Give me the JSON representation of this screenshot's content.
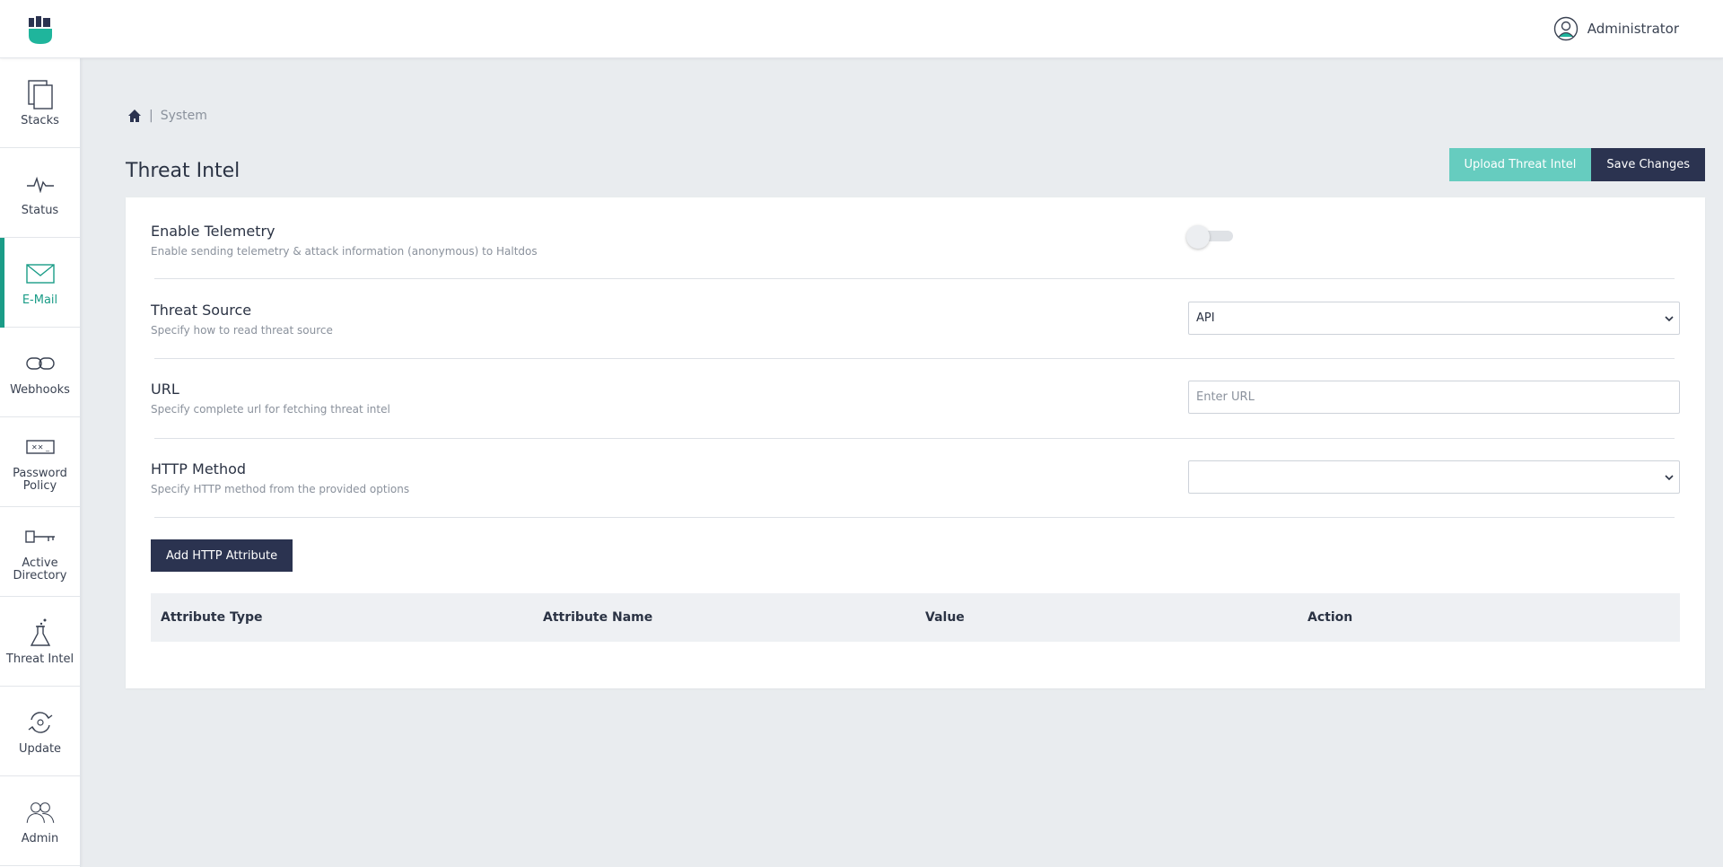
{
  "header": {
    "user_name": "Administrator"
  },
  "sidebar": {
    "items": [
      {
        "label": "Stacks",
        "icon": "stacks-icon"
      },
      {
        "label": "Status",
        "icon": "pulse-icon"
      },
      {
        "label": "E-Mail",
        "icon": "envelope-icon",
        "active": true
      },
      {
        "label": "Webhooks",
        "icon": "link-icon"
      },
      {
        "label": "Password Policy",
        "icon": "password-icon"
      },
      {
        "label": "Active Directory",
        "icon": "key-icon"
      },
      {
        "label": "Threat Intel",
        "icon": "flask-icon"
      },
      {
        "label": "Update",
        "icon": "refresh-icon"
      },
      {
        "label": "Admin",
        "icon": "users-icon"
      }
    ]
  },
  "breadcrumb": {
    "current": "System",
    "separator": "|"
  },
  "page": {
    "title": "Threat Intel",
    "upload_label": "Upload Threat Intel",
    "save_label": "Save Changes"
  },
  "form": {
    "telemetry": {
      "label": "Enable Telemetry",
      "desc": "Enable sending telemetry & attack information (anonymous) to Haltdos",
      "enabled": false
    },
    "threat_source": {
      "label": "Threat Source",
      "desc": "Specify how to read threat source",
      "value": "API"
    },
    "url": {
      "label": "URL",
      "desc": "Specify complete url for fetching threat intel",
      "placeholder": "Enter URL"
    },
    "http_method": {
      "label": "HTTP Method",
      "desc": "Specify HTTP method from the provided options",
      "value": ""
    },
    "add_attribute_label": "Add HTTP Attribute"
  },
  "table": {
    "columns": [
      "Attribute Type",
      "Attribute Name",
      "Value",
      "Action"
    ]
  },
  "colors": {
    "accent": "#1a9c87",
    "teal_button": "#66ccbf",
    "dark_button": "#2b3350",
    "background": "#e9ecef"
  }
}
